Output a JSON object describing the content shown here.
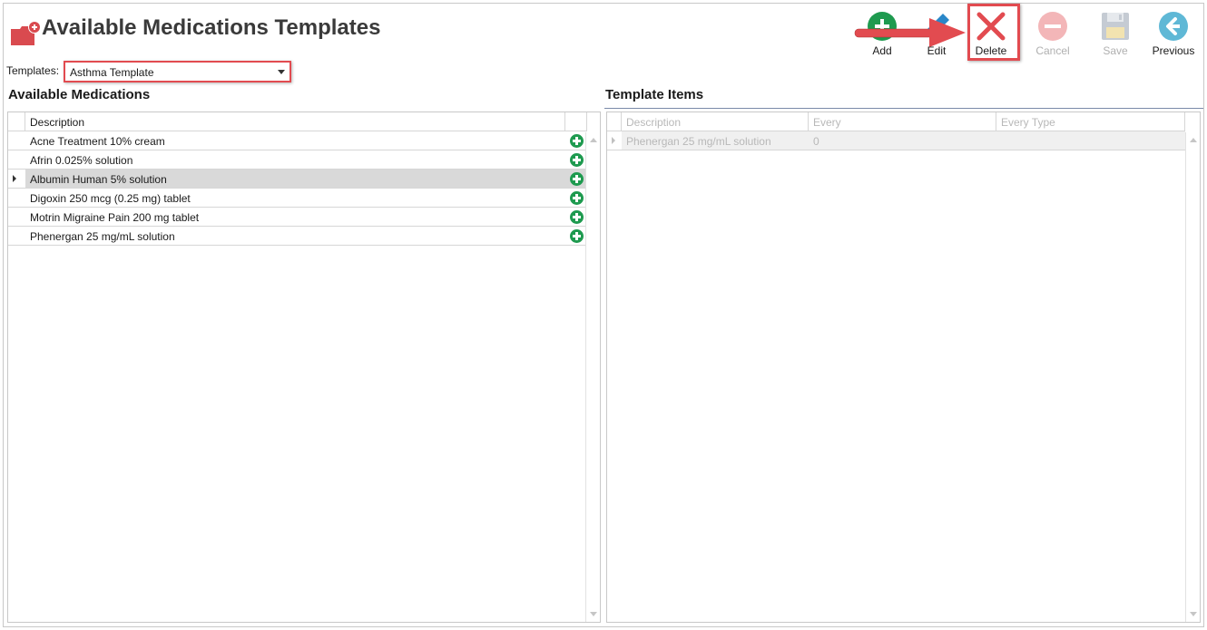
{
  "header": {
    "title": "Available Medications Templates"
  },
  "toolbar": {
    "add_label": "Add",
    "edit_label": "Edit",
    "delete_label": "Delete",
    "cancel_label": "Cancel",
    "save_label": "Save",
    "previous_label": "Previous"
  },
  "templates": {
    "label": "Templates:",
    "selected": "Asthma Template"
  },
  "available_medications": {
    "title": "Available Medications",
    "columns": [
      "Description"
    ],
    "rows": [
      {
        "description": "Acne Treatment 10% cream"
      },
      {
        "description": "Afrin 0.025% solution"
      },
      {
        "description": "Albumin Human 5% solution"
      },
      {
        "description": "Digoxin 250 mcg (0.25 mg) tablet"
      },
      {
        "description": "Motrin Migraine Pain 200 mg tablet"
      },
      {
        "description": "Phenergan 25 mg/mL solution"
      }
    ]
  },
  "template_items": {
    "title": "Template Items",
    "columns": [
      "Description",
      "Every",
      "Every Type"
    ],
    "rows": [
      {
        "description": "Phenergan 25 mg/mL solution",
        "every": "0",
        "every_type": ""
      }
    ]
  },
  "colors": {
    "add_green": "#1e9a4f",
    "edit_blue": "#2a87c8",
    "delete_red": "#e24b50",
    "cancel_disabled": "#f3b6b8",
    "previous_teal": "#5fb8d6",
    "highlight_red": "#e24b50",
    "app_icon_red": "#d94a4f"
  },
  "icons": {
    "app": "medication-folder-icon",
    "add": "plus-circle-icon",
    "edit": "pencil-icon",
    "delete": "x-icon",
    "cancel": "minus-circle-icon",
    "save": "floppy-disk-icon",
    "previous": "arrow-left-circle-icon"
  }
}
